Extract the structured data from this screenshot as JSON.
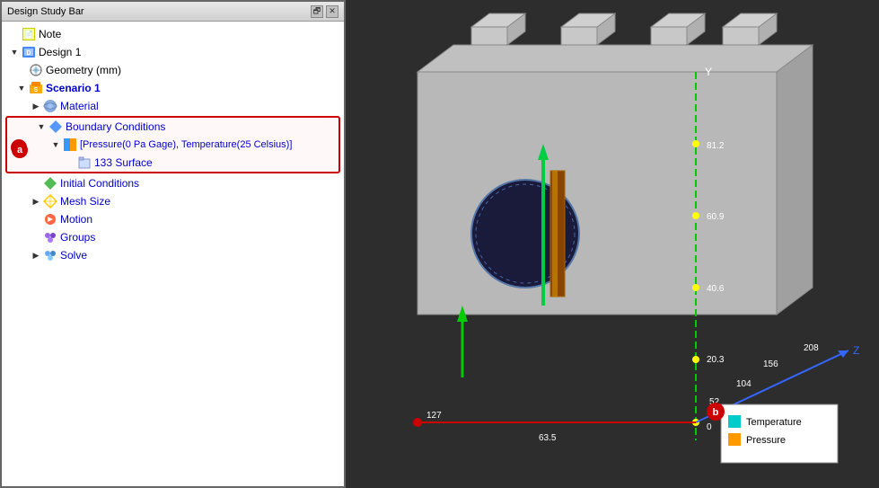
{
  "panel": {
    "title": "Design Study Bar",
    "btn_restore": "🗗",
    "btn_close": "✕"
  },
  "tree": {
    "note_label": "Note",
    "design_label": "Design 1",
    "geometry_label": "Geometry (mm)",
    "scenario_label": "Scenario 1",
    "material_label": "Material",
    "bc_label": "Boundary Conditions",
    "bc_item_label": "[Pressure(0 Pa Gage), Temperature(25 Celsius)]",
    "surface_label": "133 Surface",
    "ic_label": "Initial Conditions",
    "mesh_label": "Mesh Size",
    "motion_label": "Motion",
    "groups_label": "Groups",
    "solve_label": "Solve"
  },
  "labels": {
    "a": "a",
    "b": "b"
  },
  "legend": {
    "temperature_label": "Temperature",
    "pressure_label": "Pressure",
    "temperature_color": "#00cccc",
    "pressure_color": "#ff9900"
  },
  "axes": {
    "y_label": "Y",
    "z_label": "Z",
    "val_81": "81.2",
    "val_60": "60.9",
    "val_40": "40.6",
    "val_20": "20.3",
    "val_0": "0",
    "val_208": "208",
    "val_156": "156",
    "val_104": "104",
    "val_52": "52",
    "val_127": "127",
    "val_63": "63.5"
  }
}
